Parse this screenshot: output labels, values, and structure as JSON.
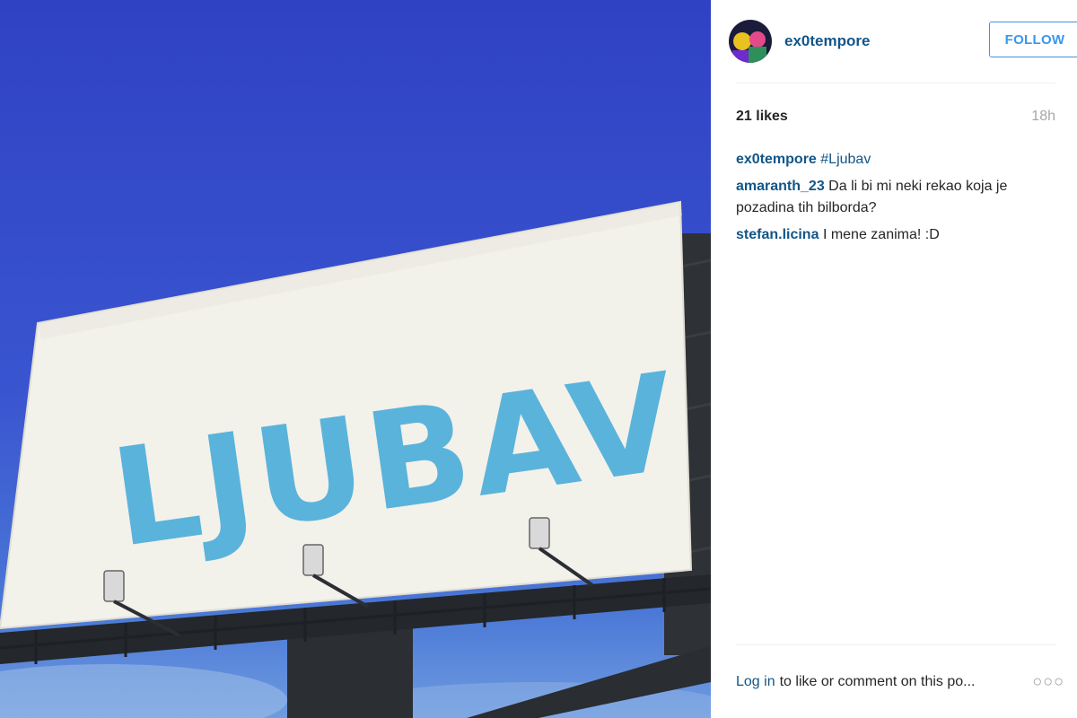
{
  "photo": {
    "billboard_text": "LJUBAV",
    "colors": {
      "sky": "#3a55d0",
      "paint": "#3fa8d8",
      "board": "#f2f1ea"
    }
  },
  "post": {
    "username": "ex0tempore",
    "follow_label": "FOLLOW",
    "likes": "21 likes",
    "time": "18h"
  },
  "comments": [
    {
      "user": "ex0tempore",
      "tag": "#Ljubav",
      "text": ""
    },
    {
      "user": "amaranth_23",
      "tag": "",
      "text": "Da li bi mi neki rekao koja je pozadina tih bilborda?"
    },
    {
      "user": "stefan.licina",
      "tag": "",
      "text": "I mene zanima! :D"
    }
  ],
  "footer": {
    "login_label": "Log in",
    "text": "to like or comment on this po...",
    "more_icon": "ellipsis-icon"
  },
  "colors": {
    "link": "#125688",
    "follow": "#3897f0",
    "muted": "#a5a7aa"
  }
}
